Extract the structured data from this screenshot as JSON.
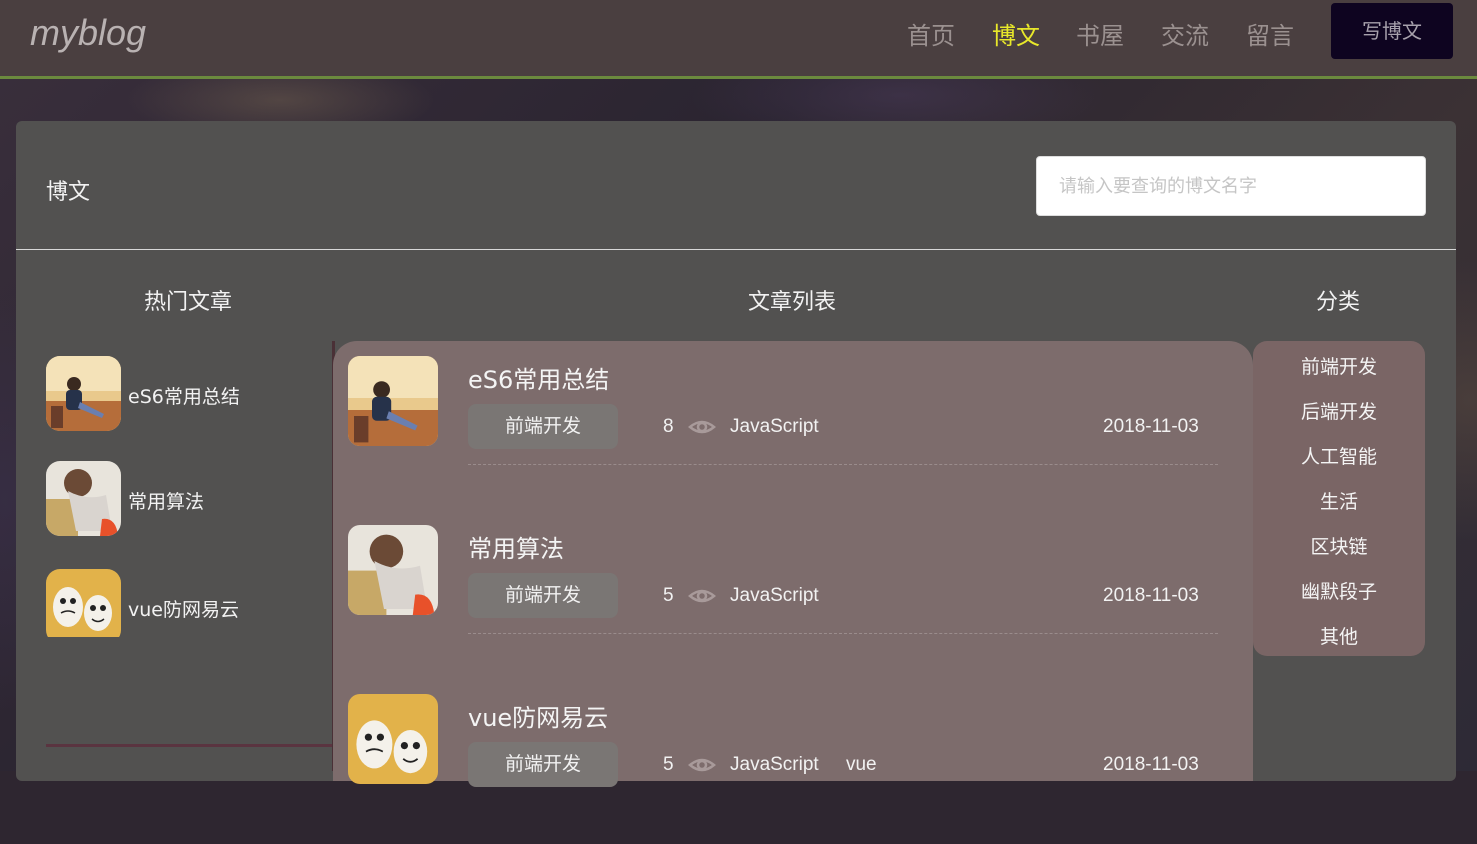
{
  "navbar": {
    "logo": "myblog",
    "items": [
      {
        "label": "首页",
        "active": false
      },
      {
        "label": "博文",
        "active": true
      },
      {
        "label": "书屋",
        "active": false
      },
      {
        "label": "交流",
        "active": false
      },
      {
        "label": "留言",
        "active": false
      }
    ],
    "write_button": "写博文",
    "active_color": "#e8e82a"
  },
  "panel": {
    "title": "博文",
    "search_placeholder": "请输入要查询的博文名字"
  },
  "columns": {
    "hot": "热门文章",
    "list": "文章列表",
    "category": "分类"
  },
  "hot_articles": [
    {
      "title": "eS6常用总结",
      "image": "autumn-girl-photo"
    },
    {
      "title": "常用算法",
      "image": "girl-suitcase-photo"
    },
    {
      "title": "vue防网易云",
      "image": "eggs-faces-photo"
    }
  ],
  "articles": [
    {
      "title": "eS6常用总结",
      "category": "前端开发",
      "views": "8",
      "tags": "JavaScript",
      "date": "2018-11-03",
      "image": "autumn-girl-photo"
    },
    {
      "title": "常用算法",
      "category": "前端开发",
      "views": "5",
      "tags": "JavaScript",
      "date": "2018-11-03",
      "image": "girl-suitcase-photo"
    },
    {
      "title": "vue防网易云",
      "category": "前端开发",
      "views": "5",
      "tags": "JavaScript vue",
      "date": "2018-11-03",
      "image": "eggs-faces-photo"
    }
  ],
  "categories": [
    "前端开发",
    "后端开发",
    "人工智能",
    "生活",
    "区块链",
    "幽默段子",
    "其他"
  ],
  "icons": {
    "views": "eye-icon"
  }
}
